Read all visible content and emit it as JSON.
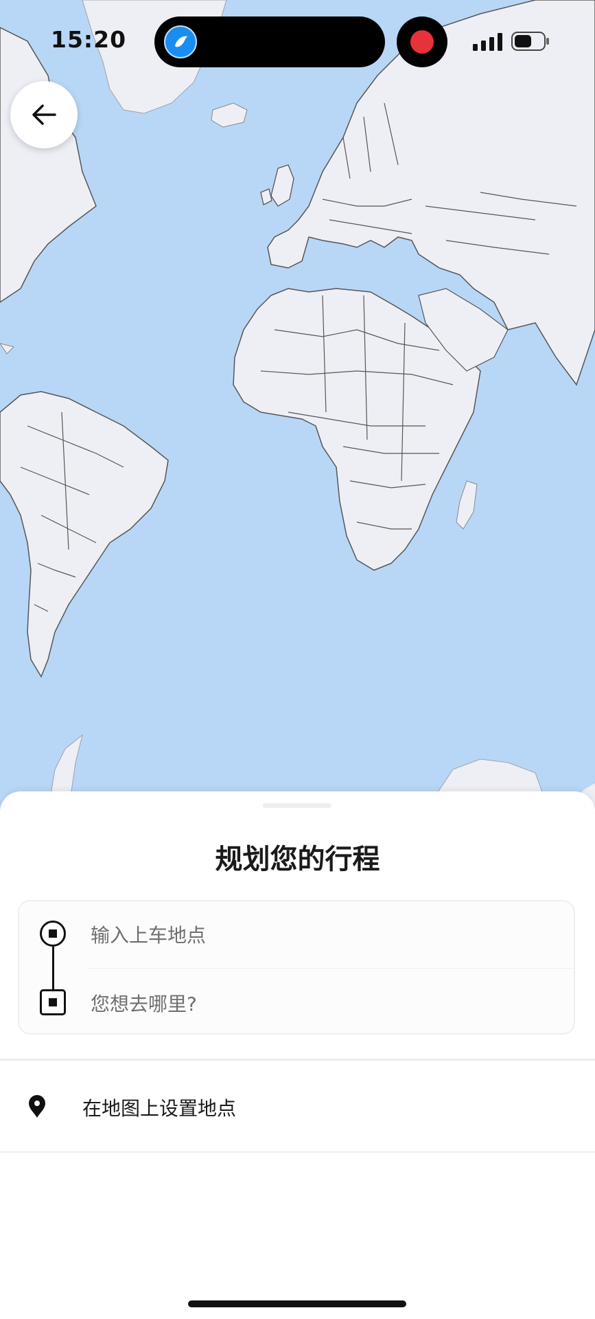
{
  "status_bar": {
    "time": "15:20"
  },
  "icons": {
    "back": "arrow-left-icon",
    "pickup": "pickup-marker-icon",
    "dropoff": "dropoff-marker-icon",
    "set_on_map": "map-pin-icon",
    "signal": "cellular-signal-icon",
    "battery": "battery-icon",
    "record": "screen-record-icon",
    "island_app": "app-icon"
  },
  "colors": {
    "ocean": "#b8d7f7",
    "land": "#eeeff5",
    "border": "#555555",
    "record": "#e8323a",
    "text_primary": "#1a1a1a",
    "placeholder": "#6f6f6f"
  },
  "sheet": {
    "title": "规划您的行程",
    "pickup_placeholder": "输入上车地点",
    "dropoff_placeholder": "您想去哪里?",
    "set_on_map_label": "在地图上设置地点"
  }
}
